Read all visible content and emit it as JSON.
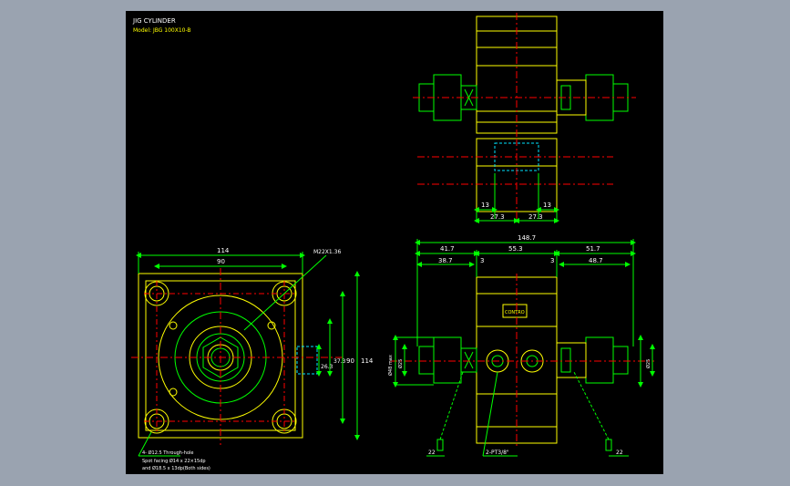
{
  "title": {
    "line1": "JIG CYLINDER",
    "line2": "Model: JBG 100X10-B"
  },
  "colors": {
    "background": "#000000",
    "outline": "#ffff00",
    "detail": "#00ff00",
    "center": "#ff0000",
    "hidden": "#00e5ff",
    "dimension": "#00ff00",
    "text": "#ffffff"
  },
  "front_view": {
    "dims": {
      "width_total": "114",
      "width_holes": "90",
      "height_total": "114",
      "height_holes": "90",
      "port_offset": "37.3",
      "port_height": "26.3",
      "thread": "M22X1.36"
    },
    "notes": {
      "line1": "4- Ø12.5 Through-hole",
      "line2": "Spot facing Ø14 x 22×15dp",
      "line3": "and Ø18.5 x 13dp(Both sides)"
    }
  },
  "top_view": {
    "dims": {
      "left_small": "13",
      "right_small": "13",
      "left_offset": "27.3",
      "right_offset": "27.3"
    }
  },
  "side_view": {
    "dims": {
      "overall": "148.7",
      "seg_left": "41.7",
      "seg_mid": "55.3",
      "seg_right": "51.7",
      "inner_left": "38.7",
      "inner_right": "48.7",
      "gap_left": "3",
      "gap_right": "3",
      "dia_left_outer": "Ø48 max",
      "dia_left_inner": "Ø25",
      "dia_right": "Ø25",
      "port_label": "2-PT3/8\"",
      "label_left": "22",
      "label_right": "22",
      "badge": "CONTRO"
    }
  }
}
